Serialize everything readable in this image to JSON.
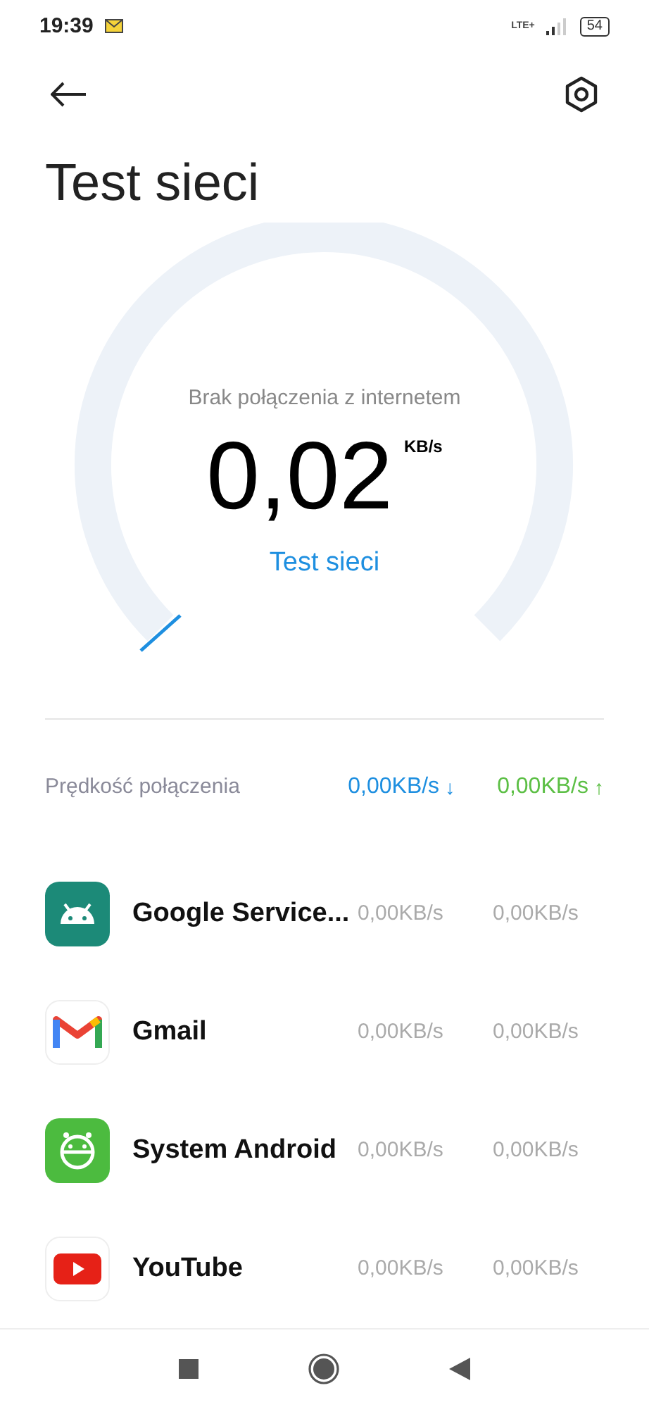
{
  "status_bar": {
    "time": "19:39",
    "network": "LTE+",
    "battery": "54"
  },
  "header": {
    "title": "Test sieci"
  },
  "gauge": {
    "status": "Brak połączenia z internetem",
    "value": "0,02",
    "unit": "KB/s",
    "action": "Test sieci"
  },
  "speed": {
    "label": "Prędkość połączenia",
    "download": "0,00KB/s",
    "download_arrow": "↓",
    "upload": "0,00KB/s",
    "upload_arrow": "↑"
  },
  "apps": [
    {
      "kind": "android",
      "name": "Google Service...",
      "download": "0,00KB/s",
      "upload": "0,00KB/s"
    },
    {
      "kind": "gmail",
      "name": "Gmail",
      "download": "0,00KB/s",
      "upload": "0,00KB/s"
    },
    {
      "kind": "system",
      "name": "System Android",
      "download": "0,00KB/s",
      "upload": "0,00KB/s"
    },
    {
      "kind": "youtube",
      "name": "YouTube",
      "download": "0,00KB/s",
      "upload": "0,00KB/s"
    }
  ]
}
